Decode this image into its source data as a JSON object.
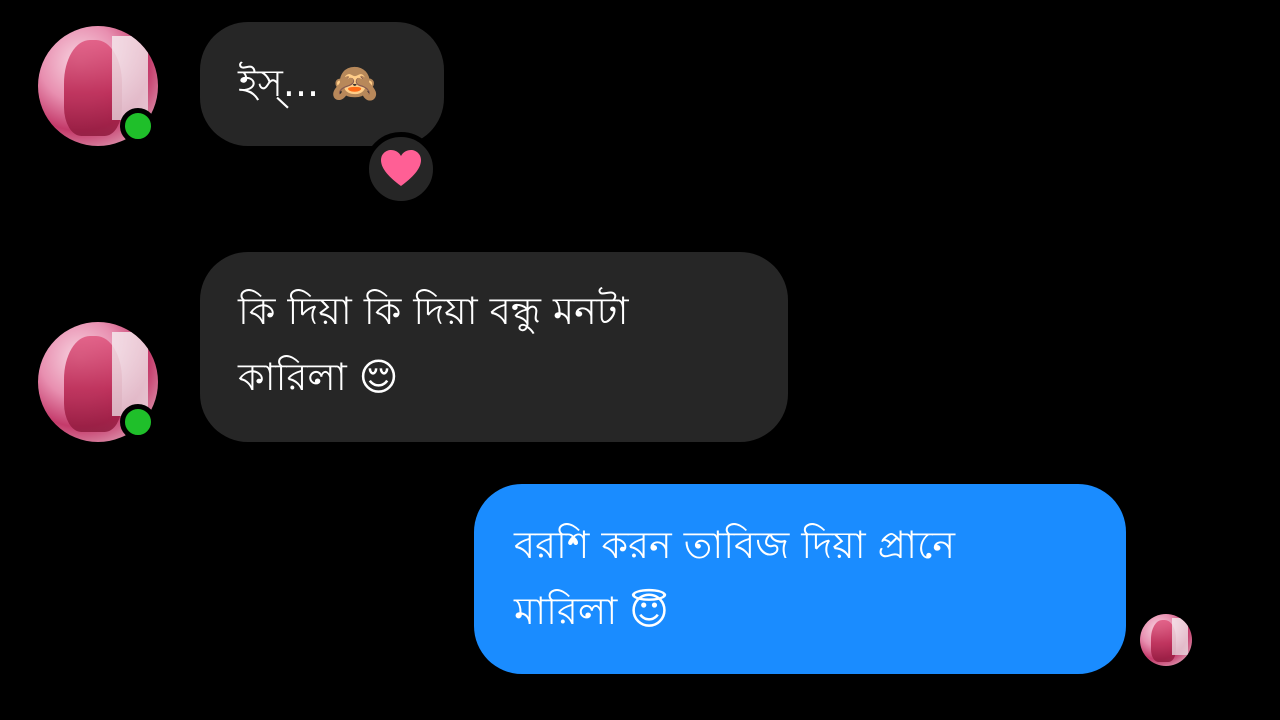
{
  "messages": [
    {
      "direction": "incoming",
      "lines": [
        "ইস্... 🙈"
      ],
      "reaction": "heart-icon"
    },
    {
      "direction": "incoming",
      "lines": [
        "কি দিয়া কি দিয়া বন্ধু মনটা",
        "কারিলা 😌"
      ]
    },
    {
      "direction": "outgoing",
      "lines": [
        "বরশি করন তাবিজ দিয়া প্রানে",
        "মারিলা 😇"
      ]
    }
  ],
  "colors": {
    "background": "#000000",
    "incoming_bubble": "#262626",
    "outgoing_bubble": "#1a8cff",
    "online_dot": "#1fbf2a",
    "heart": "#ff5f95"
  }
}
